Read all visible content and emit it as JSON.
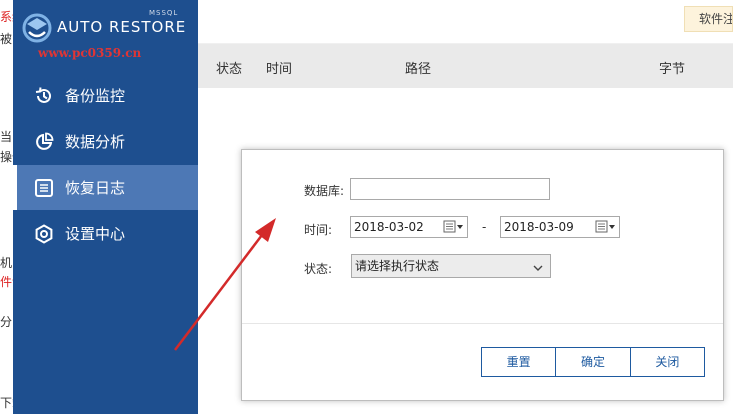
{
  "app": {
    "brand": "AUTO RESTORE",
    "brand_small": "MSSQL",
    "watermark": "www.pc0359.cn"
  },
  "background_fragments": [
    {
      "text": "系统",
      "color": "red"
    },
    {
      "text": "被",
      "color": "dark"
    },
    {
      "text": "当",
      "color": "dark"
    },
    {
      "text": "操作",
      "color": "dark"
    },
    {
      "text": "机",
      "color": "dark"
    },
    {
      "text": "件读",
      "color": "red"
    },
    {
      "text": "分",
      "color": "dark"
    },
    {
      "text": "下载",
      "color": "dark"
    }
  ],
  "sidebar": {
    "items": [
      {
        "label": "备份监控",
        "icon": "backup-history-icon",
        "active": false
      },
      {
        "label": "数据分析",
        "icon": "pie-chart-icon",
        "active": false
      },
      {
        "label": "恢复日志",
        "icon": "log-list-icon",
        "active": true
      },
      {
        "label": "设置中心",
        "icon": "settings-icon",
        "active": false
      }
    ]
  },
  "topbar": {
    "tag_label": "软件注"
  },
  "table": {
    "columns": [
      "状态",
      "时间",
      "路径",
      "字节"
    ]
  },
  "dialog": {
    "database_label": "数据库:",
    "database_value": "",
    "time_label": "时间:",
    "date_from": "2018-03-02",
    "date_separator": "-",
    "date_to": "2018-03-09",
    "status_label": "状态:",
    "status_value": "请选择执行状态",
    "buttons": {
      "reset": "重置",
      "confirm": "确定",
      "close": "关闭"
    }
  },
  "colors": {
    "sidebar_bg": "#1e4f8f",
    "sidebar_active": "#4d78b5",
    "accent_button": "#1e5aa0",
    "arrow": "#d32a2a"
  }
}
